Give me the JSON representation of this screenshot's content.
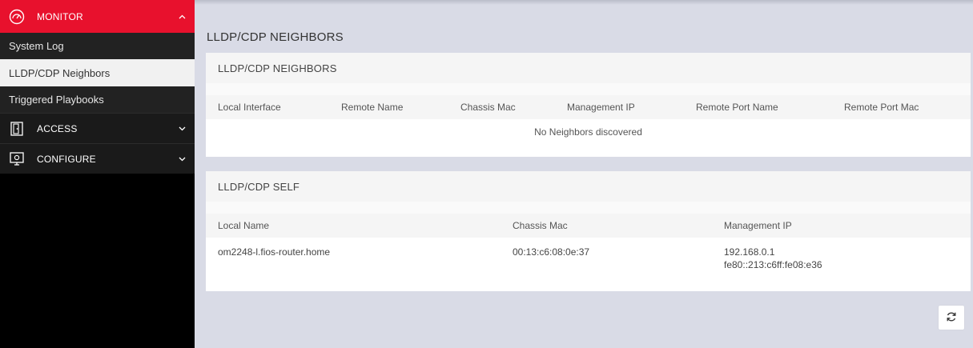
{
  "sidebar": {
    "monitor": {
      "label": "MONITOR",
      "icon": "gauge-icon",
      "chevron": "chevron-up-icon"
    },
    "monitor_items": [
      {
        "label": "System Log",
        "active": false
      },
      {
        "label": "LLDP/CDP Neighbors",
        "active": true
      },
      {
        "label": "Triggered Playbooks",
        "active": false
      }
    ],
    "access": {
      "label": "ACCESS",
      "icon": "door-icon",
      "chevron": "chevron-down-icon"
    },
    "configure": {
      "label": "CONFIGURE",
      "icon": "monitor-gear-icon",
      "chevron": "chevron-down-icon"
    }
  },
  "page": {
    "title": "LLDP/CDP NEIGHBORS"
  },
  "neighbors": {
    "title": "LLDP/CDP NEIGHBORS",
    "columns": [
      "Local Interface",
      "Remote Name",
      "Chassis Mac",
      "Management IP",
      "Remote Port Name",
      "Remote Port Mac"
    ],
    "empty_message": "No Neighbors discovered"
  },
  "self": {
    "title": "LLDP/CDP SELF",
    "columns": [
      "Local Name",
      "Chassis Mac",
      "Management IP"
    ],
    "row": {
      "local_name": "om2248-l.fios-router.home",
      "chassis_mac": "00:13:c6:08:0e:37",
      "management_ip_1": "192.168.0.1",
      "management_ip_2": "fe80::213:c6ff:fe08:e36"
    }
  },
  "refresh": {
    "icon": "refresh-icon"
  },
  "colors": {
    "accent": "#e8112d",
    "sidebar_bg": "#000000",
    "content_bg": "#d9dbe6"
  }
}
